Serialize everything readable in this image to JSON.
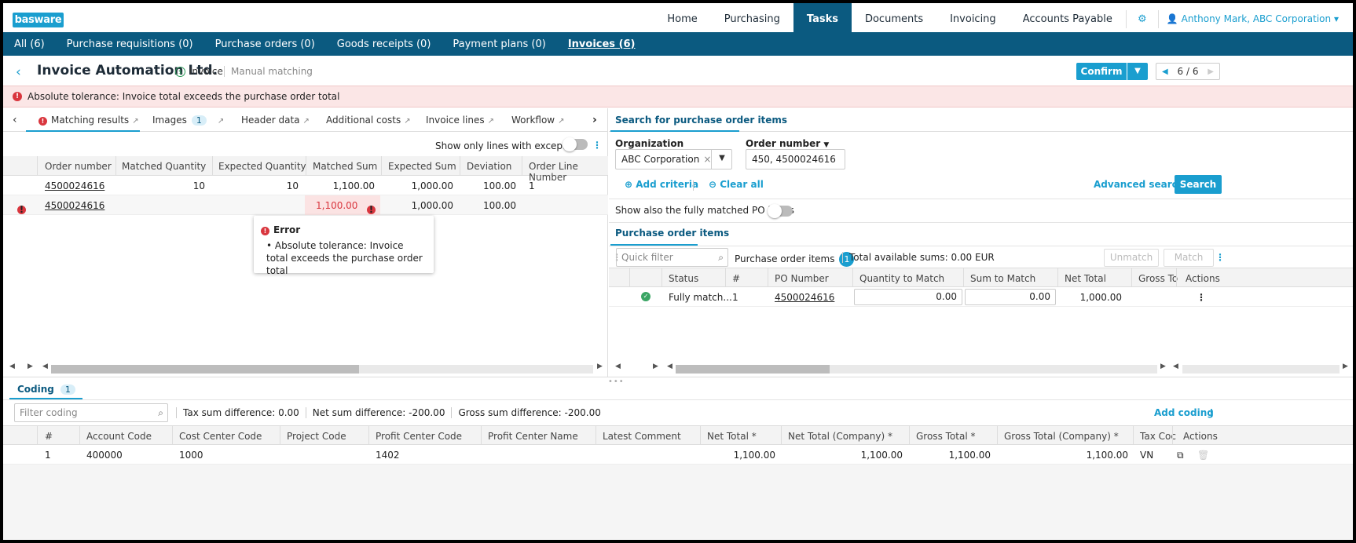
{
  "app": {
    "logo": "basware"
  },
  "topnav": {
    "items": [
      "Home",
      "Purchasing",
      "Tasks",
      "Documents",
      "Invoicing",
      "Accounts Payable"
    ],
    "active": "Tasks",
    "user": "Anthony Mark, ABC Corporation"
  },
  "subnav": {
    "items": [
      "All (6)",
      "Purchase requisitions (0)",
      "Purchase orders (0)",
      "Goods receipts (0)",
      "Payment plans (0)",
      "Invoices (6)"
    ],
    "active": "Invoices (6)"
  },
  "header": {
    "title": "Invoice Automation Ltd.",
    "doc_type": "Invoice",
    "subtitle": "Manual matching",
    "confirm_label": "Confirm",
    "pager": "6 / 6"
  },
  "banner": {
    "message": "Absolute tolerance: Invoice total exceeds the purchase order total"
  },
  "left_tabs": {
    "items": [
      {
        "label": "Matching results",
        "badge": ""
      },
      {
        "label": "Images",
        "badge": "1"
      },
      {
        "label": "Header data",
        "badge": ""
      },
      {
        "label": "Additional costs",
        "badge": ""
      },
      {
        "label": "Invoice lines",
        "badge": ""
      },
      {
        "label": "Workflow",
        "badge": ""
      }
    ]
  },
  "matching": {
    "exceptions_toggle_label": "Show only lines with exceptions",
    "columns": [
      "Order number",
      "Matched Quantity",
      "Expected Quantity",
      "Matched Sum",
      "Expected Sum",
      "Deviation",
      "Order Line Number"
    ],
    "rows": [
      {
        "order_number": "4500024616",
        "matched_qty": "10",
        "expected_qty": "10",
        "matched_sum": "1,100.00",
        "expected_sum": "1,000.00",
        "deviation": "100.00",
        "line": "1"
      },
      {
        "order_number": "4500024616",
        "matched_qty": "",
        "expected_qty": "",
        "matched_sum": "1,100.00",
        "expected_sum": "1,000.00",
        "deviation": "100.00",
        "line": ""
      }
    ],
    "tooltip": {
      "title": "Error",
      "body": "Absolute tolerance: Invoice total exceeds the purchase order total"
    }
  },
  "search": {
    "tab_label": "Search for purchase order items",
    "organization_label": "Organization",
    "organization_value": "ABC Corporation",
    "order_number_label": "Order number",
    "order_number_value": "450, 4500024616",
    "add_criteria": "Add criteria",
    "clear_all": "Clear all",
    "advanced_search": "Advanced search",
    "search_button": "Search",
    "fully_matched_label": "Show also the fully matched PO items"
  },
  "po_items": {
    "tab_label": "Purchase order items",
    "quick_filter_placeholder": "Quick filter",
    "count_label": "Purchase order items",
    "count": "1",
    "total_available": "Total available sums: 0.00  EUR",
    "unmatch_label": "Unmatch",
    "match_label": "Match",
    "columns": [
      "Status",
      "#",
      "PO Number",
      "Quantity to Match",
      "Sum to Match",
      "Net Total",
      "Gross To",
      "Actions"
    ],
    "rows": [
      {
        "status": "Fully match...",
        "num": "1",
        "po_number": "4500024616",
        "qty_to_match": "0.00",
        "sum_to_match": "0.00",
        "net_total": "1,000.00"
      }
    ]
  },
  "coding": {
    "tab_label": "Coding",
    "count": "1",
    "filter_placeholder": "Filter coding",
    "tax_diff": "Tax sum difference: 0.00",
    "net_diff": "Net sum difference: -200.00",
    "gross_diff": "Gross sum difference: -200.00",
    "add_coding": "Add coding",
    "columns": [
      "#",
      "Account Code",
      "Cost Center Code",
      "Project Code",
      "Profit Center Code",
      "Profit Center Name",
      "Latest Comment",
      "Net Total *",
      "Net Total (Company) *",
      "Gross Total *",
      "Gross Total (Company) *",
      "Tax Coc",
      "Actions"
    ],
    "rows": [
      {
        "num": "1",
        "account": "400000",
        "cost_center": "1000",
        "project": "",
        "profit_center": "1402",
        "profit_center_name": "",
        "comment": "",
        "net_total": "1,100.00",
        "net_total_company": "1,100.00",
        "gross_total": "1,100.00",
        "gross_total_company": "1,100.00",
        "tax_code": "VN"
      }
    ]
  },
  "colors": {
    "brand": "#1a9ecf",
    "nav": "#0b5a80",
    "error": "#d9363e",
    "success": "#3aa564"
  }
}
